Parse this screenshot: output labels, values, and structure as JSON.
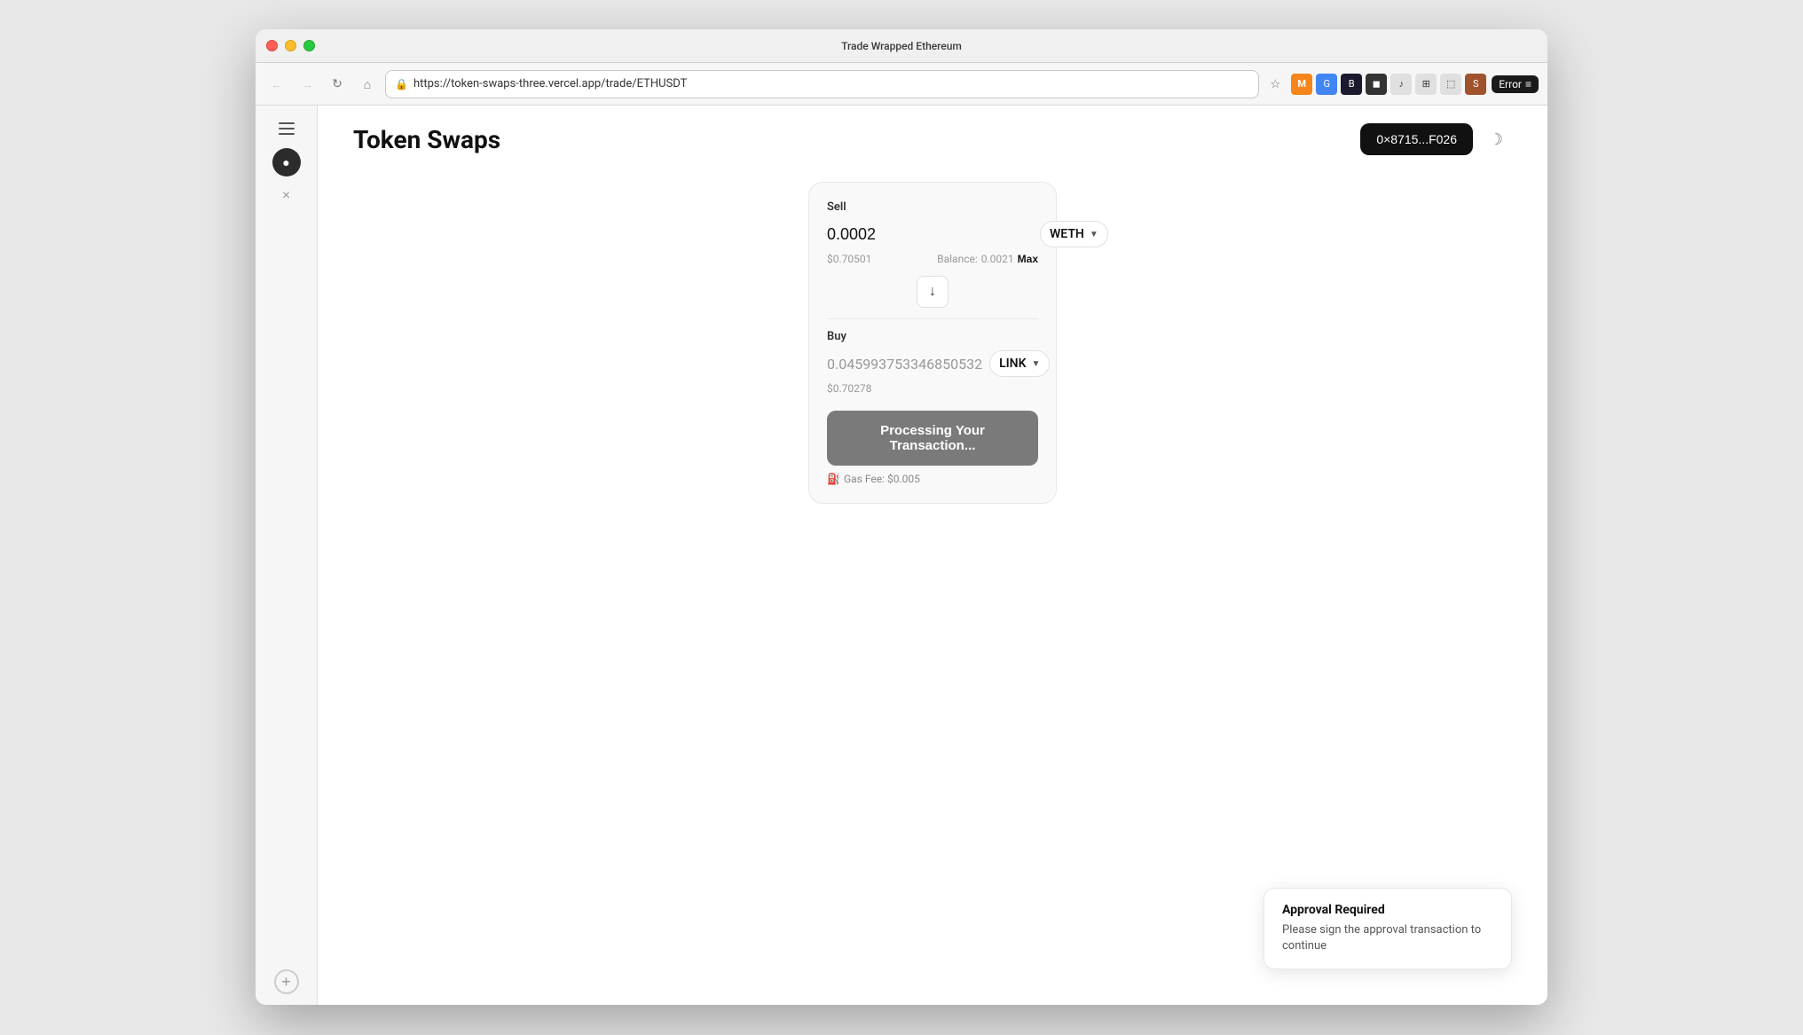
{
  "window": {
    "title": "Trade Wrapped Ethereum"
  },
  "browser": {
    "url": "https://token-swaps-three.vercel.app/trade/ETHUSDT",
    "back_disabled": true,
    "forward_disabled": true,
    "error_badge": "Error"
  },
  "app": {
    "title": "Token Swaps",
    "wallet_address": "0×8715...F026",
    "theme_toggle_icon": "☽"
  },
  "swap": {
    "sell_label": "Sell",
    "sell_amount": "0.0002",
    "sell_token": "WETH",
    "sell_usd": "$0.70501",
    "balance_label": "Balance:",
    "balance_value": "0.0021",
    "max_label": "Max",
    "swap_arrow": "↓",
    "buy_label": "Buy",
    "buy_amount": "0.045993753346850532",
    "buy_token": "LINK",
    "buy_usd": "$0.70278",
    "process_btn_label": "Processing Your Transaction...",
    "gas_fee_label": "Gas Fee: $0.005"
  },
  "approval_toast": {
    "title": "Approval Required",
    "text": "Please sign the approval transaction to continue"
  }
}
